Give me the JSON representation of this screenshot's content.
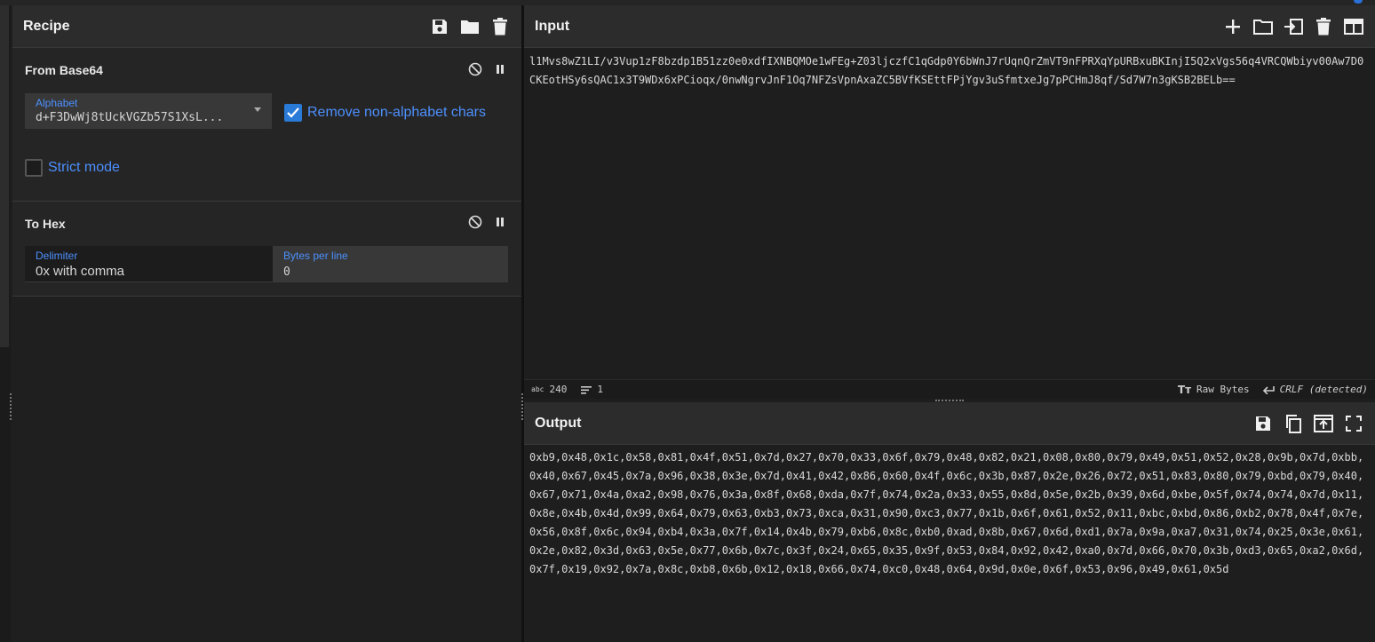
{
  "recipe": {
    "title": "Recipe",
    "operations": [
      {
        "name": "From Base64",
        "alphabet_label": "Alphabet",
        "alphabet_value": "d+F3DwWj8tUckVGZb57S1XsL...",
        "remove_label": "Remove non-alphabet chars",
        "strict_label": "Strict mode"
      },
      {
        "name": "To Hex",
        "delimiter_label": "Delimiter",
        "delimiter_value": "0x with comma",
        "bpl_label": "Bytes per line",
        "bpl_value": "0"
      }
    ]
  },
  "input": {
    "title": "Input",
    "text": "l1Mvs8wZ1LI/v3Vup1zF8bzdp1B51zz0e0xdfIXNBQMOe1wFEg+Z03ljczfC1qGdp0Y6bWnJ7rUqnQrZmVT9nFPRXqYpURBxuBKInjI5Q2xVgs56q4VRCQWbiyv00Aw7D0CKEotHSy6sQAC1x3T9WDx6xPCioqx/0nwNgrvJnF1Oq7NFZsVpnAxaZC5BVfKSEttFPjYgv3uSfmtxeJg7pPCHmJ8qf/Sd7W7n3gKSB2BELb==",
    "length": "240",
    "lines": "1",
    "raw_bytes": "Raw Bytes",
    "crlf": "CRLF (detected)"
  },
  "output": {
    "title": "Output",
    "text": "0xb9,0x48,0x1c,0x58,0x81,0x4f,0x51,0x7d,0x27,0x70,0x33,0x6f,0x79,0x48,0x82,0x21,0x08,0x80,0x79,0x49,0x51,0x52,0x28,0x9b,0x7d,0xbb,0x40,0x67,0x45,0x7a,0x96,0x38,0x3e,0x7d,0x41,0x42,0x86,0x60,0x4f,0x6c,0x3b,0x87,0x2e,0x26,0x72,0x51,0x83,0x80,0x79,0xbd,0x79,0x40,0x67,0x71,0x4a,0xa2,0x98,0x76,0x3a,0x8f,0x68,0xda,0x7f,0x74,0x2a,0x33,0x55,0x8d,0x5e,0x2b,0x39,0x6d,0xbe,0x5f,0x74,0x74,0x7d,0x11,0x8e,0x4b,0x4d,0x99,0x64,0x79,0x63,0xb3,0x73,0xca,0x31,0x90,0xc3,0x77,0x1b,0x6f,0x61,0x52,0x11,0xbc,0xbd,0x86,0xb2,0x78,0x4f,0x7e,0x56,0x8f,0x6c,0x94,0xb4,0x3a,0x7f,0x14,0x4b,0x79,0xb6,0x8c,0xb0,0xad,0x8b,0x67,0x6d,0xd1,0x7a,0x9a,0xa7,0x31,0x74,0x25,0x3e,0x61,0x2e,0x82,0x3d,0x63,0x5e,0x77,0x6b,0x7c,0x3f,0x24,0x65,0x35,0x9f,0x53,0x84,0x92,0x42,0xa0,0x7d,0x66,0x70,0x3b,0xd3,0x65,0xa2,0x6d,0x7f,0x19,0x92,0x7a,0x8c,0xb8,0x6b,0x12,0x18,0x66,0x74,0xc0,0x48,0x64,0x9d,0x0e,0x6f,0x53,0x96,0x49,0x61,0x5d"
  }
}
